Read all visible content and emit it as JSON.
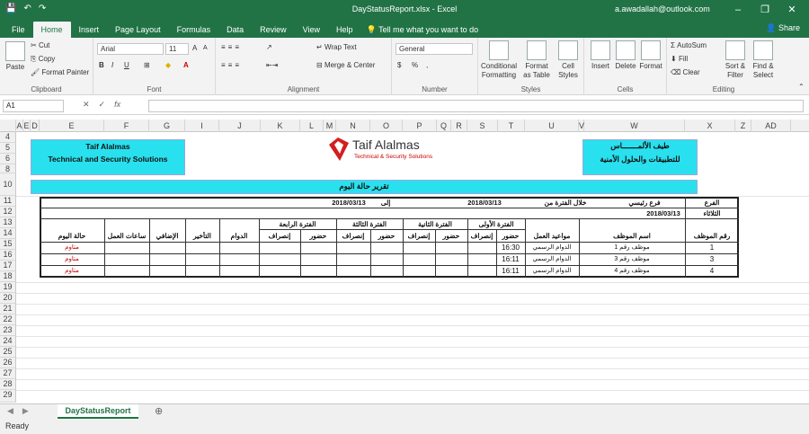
{
  "window": {
    "title": "DayStatusReport.xlsx - Excel",
    "user": "a.awadallah@outlook.com",
    "quick_access": [
      "💾",
      "↶",
      "↷"
    ],
    "controls": [
      "–",
      "❐",
      "✕"
    ],
    "ribbon_display_icon": "ribbon-display-options-icon"
  },
  "tabs": [
    "File",
    "Home",
    "Insert",
    "Page Layout",
    "Formulas",
    "Data",
    "Review",
    "View",
    "Help"
  ],
  "tell_me": "Tell me what you want to do",
  "share": "Share",
  "ribbon": {
    "clipboard": {
      "label": "Clipboard",
      "paste": "Paste",
      "cut": "Cut",
      "copy": "Copy",
      "format_painter": "Format Painter"
    },
    "font": {
      "label": "Font",
      "name": "Arial",
      "size": "11",
      "bold": "B",
      "italic": "I",
      "underline": "U",
      "grow": "A",
      "shrink": "A"
    },
    "alignment": {
      "label": "Alignment",
      "wrap": "Wrap Text",
      "merge": "Merge & Center"
    },
    "number": {
      "label": "Number",
      "format": "General",
      "currency": "$",
      "percent": "%",
      "comma": ","
    },
    "styles": {
      "label": "Styles",
      "conditional": "Conditional Formatting",
      "format_table": "Format as Table",
      "cell_styles": "Cell Styles"
    },
    "cells": {
      "label": "Cells",
      "insert": "Insert",
      "delete": "Delete",
      "format": "Format"
    },
    "editing": {
      "label": "Editing",
      "autosum": "AutoSum",
      "fill": "Fill",
      "clear": "Clear",
      "sort": "Sort & Filter",
      "find": "Find & Select"
    }
  },
  "formula_bar": {
    "name_box": "A1",
    "icons": [
      "✕",
      "✓",
      "fx"
    ],
    "formula": ""
  },
  "columns": [
    "A",
    "E",
    "D",
    "E",
    "F",
    "G",
    "I",
    "J",
    "K",
    "L",
    "M",
    "N",
    "O",
    "P",
    "Q",
    "R",
    "S",
    "T",
    "U",
    "V",
    "W",
    "X",
    "Z",
    "AD"
  ],
  "rows": [
    "4",
    "5",
    "6",
    "8",
    "10",
    "11",
    "12",
    "13",
    "14",
    "15",
    "16",
    "17",
    "18",
    "19",
    "20",
    "21",
    "22",
    "23",
    "24",
    "25",
    "26",
    "27",
    "28",
    "29"
  ],
  "header": {
    "company_en_line1": "Taif Alalmas",
    "company_en_line2": "Technical and Security Solutions",
    "logo_name": "Taif Alalmas",
    "logo_tagline": "Technical & Security Solutions",
    "company_ar_line1": "طيف الألمـــــــاس",
    "company_ar_line2": "للتطبيقات والحلول الأمنية",
    "report_title": "تقرير حالة اليوم"
  },
  "report": {
    "branch_label": "الفرع",
    "branch_value": "فرع رئيسي",
    "period_label": "خلال الفترة من",
    "date_from": "2018/03/13",
    "to_label": "إلى",
    "date_to": "2018/03/13",
    "date_current": "2018/03/13",
    "day_name": "الثلاثاء",
    "periods": [
      "الفترة الأولى",
      "الفترة الثانية",
      "الفترة الثالثة",
      "الفترة الرابعة"
    ],
    "columns": {
      "emp_no": "رقم الموظف",
      "emp_name": "اسم الموظف",
      "work_time": "مواعيد العمل",
      "in": "حضور",
      "out": "إنصراف",
      "absence": "الدوام",
      "delay": "التأخير",
      "overtime": "الإضافي",
      "hours": "ساعات العمل",
      "day_status": "حالة اليوم"
    },
    "rows": [
      {
        "emp_no": "1",
        "emp_name": "موظف رقم 1",
        "work_time": "الدوام الرسمي",
        "in1": "16:30",
        "status": "متاوم"
      },
      {
        "emp_no": "3",
        "emp_name": "موظف رقم 3",
        "work_time": "الدوام الرسمي",
        "in1": "16:11",
        "status": "متاوم"
      },
      {
        "emp_no": "4",
        "emp_name": "موظف رقم 4",
        "work_time": "الدوام الرسمي",
        "in1": "16:11",
        "status": "متاوم"
      }
    ]
  },
  "sheet_tab": "DayStatusReport",
  "add_sheet_icon": "⊕",
  "status": "Ready",
  "colors": {
    "excel_green": "#217346",
    "header_cyan": "#29e0ee",
    "red_text": "#c00000"
  }
}
